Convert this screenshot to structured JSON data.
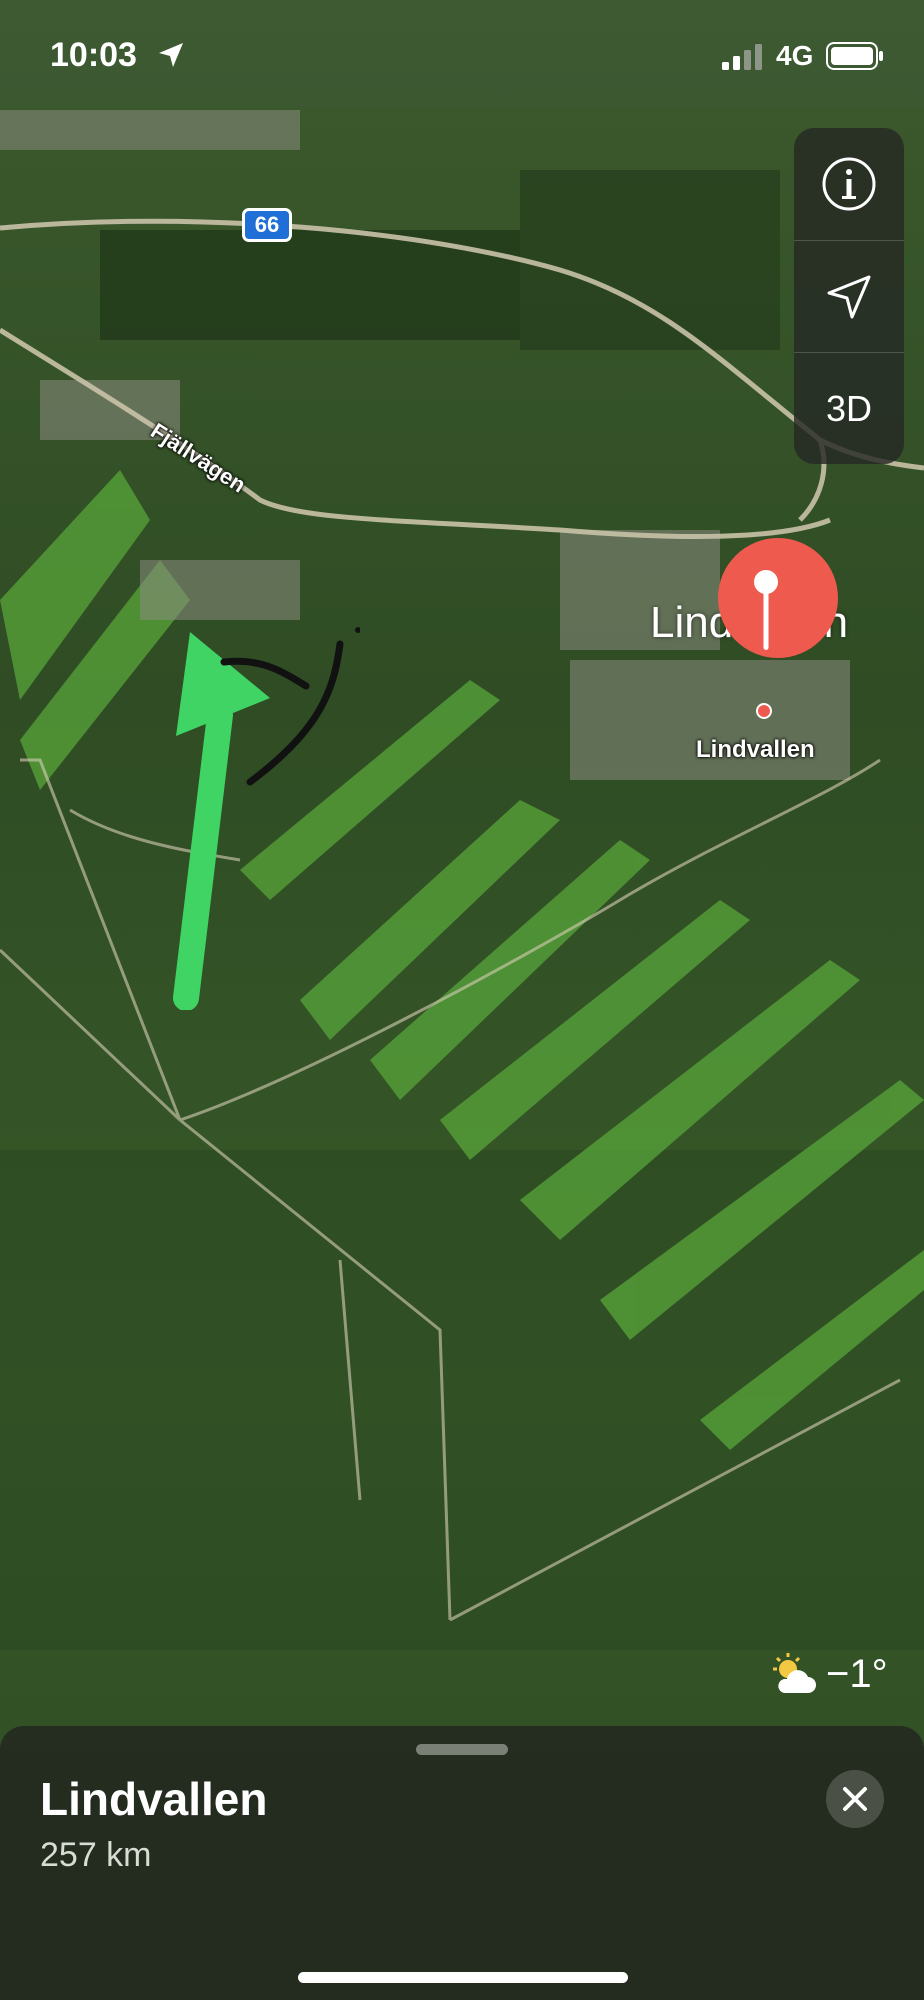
{
  "status_bar": {
    "time": "10:03",
    "network": "4G",
    "location_icon": "location-arrow-icon",
    "signal_icon": "signal-bars-icon",
    "battery_icon": "battery-icon"
  },
  "map": {
    "route_shield": "66",
    "street_label": "Fjällvägen",
    "area_label": "Lindvallen",
    "pin_label": "Lindvallen",
    "pin_icon": "map-pin-icon",
    "annotation_arrow_icon": "green-arrow-icon",
    "annotation_scribble_icon": "black-scribble-icon"
  },
  "controls": {
    "info_icon": "info-icon",
    "locate_icon": "navigation-arrow-icon",
    "view_3d_label": "3D"
  },
  "weather": {
    "icon": "partly-sunny-icon",
    "temperature": "−1°"
  },
  "sheet": {
    "title": "Lindvallen",
    "distance": "257 km",
    "close_icon": "close-icon"
  },
  "colors": {
    "pin_red": "#ee5b4e",
    "arrow_green": "#3fd464",
    "shield_blue": "#1f6fd6"
  }
}
